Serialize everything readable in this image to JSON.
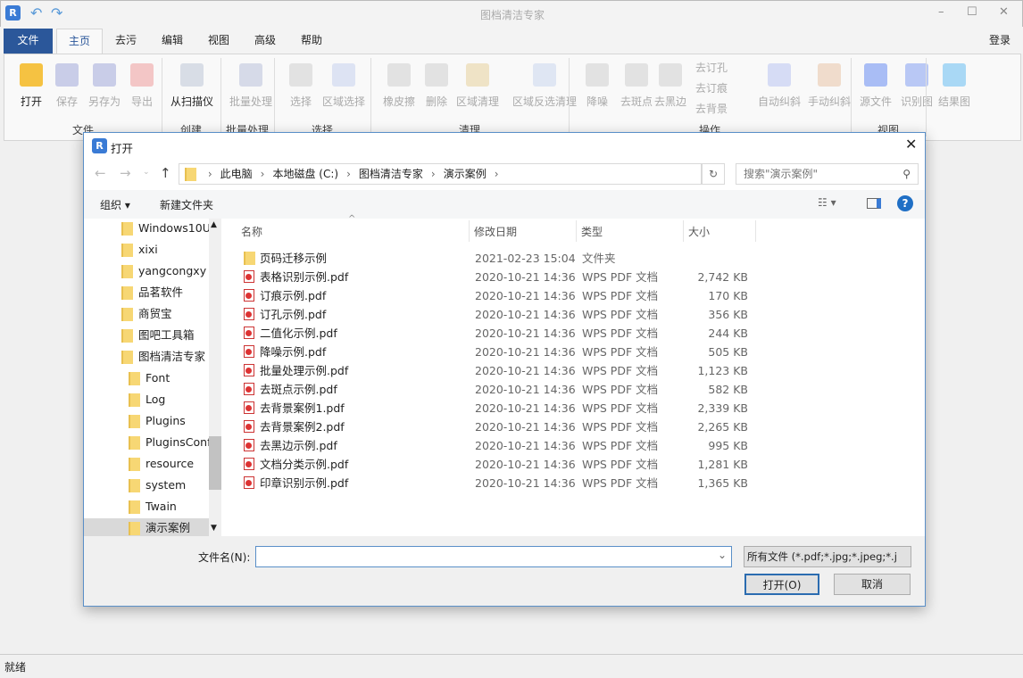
{
  "window": {
    "title": "图档清洁专家",
    "minimize": "–",
    "maximize": "☐",
    "close": "✕",
    "login": "登录",
    "icon": "app-logo-icon"
  },
  "tabs": [
    {
      "label": "文件"
    },
    {
      "label": "主页"
    },
    {
      "label": "去污"
    },
    {
      "label": "编辑"
    },
    {
      "label": "视图"
    },
    {
      "label": "高级"
    },
    {
      "label": "帮助"
    }
  ],
  "ribbon": {
    "buttons": [
      {
        "label": "打开",
        "icon": "folder-open-icon",
        "color": "#f5c242"
      },
      {
        "label": "保存",
        "icon": "save-icon",
        "color": "#c9cde8"
      },
      {
        "label": "另存为",
        "icon": "save-as-icon",
        "color": "#c9cde8"
      },
      {
        "label": "导出",
        "icon": "export-icon",
        "color": "#f3c6c6"
      },
      {
        "label": "从扫描仪",
        "icon": "scanner-icon",
        "color": "#d8dde6"
      },
      {
        "label": "批量处理",
        "icon": "batch-icon",
        "color": "#d6dae8"
      },
      {
        "label": "选择",
        "icon": "cursor-icon",
        "color": "#e2e2e2"
      },
      {
        "label": "区域选择",
        "icon": "area-select-icon",
        "color": "#dde3f3"
      },
      {
        "label": "橡皮擦",
        "icon": "eraser-icon",
        "color": "#e2e2e2"
      },
      {
        "label": "删除",
        "icon": "trash-icon",
        "color": "#e2e2e2"
      },
      {
        "label": "区域清理",
        "icon": "area-clean-icon",
        "color": "#efe3c6"
      },
      {
        "label": "区域反选清理",
        "icon": "area-invert-clean-icon",
        "color": "#dfe6f3"
      },
      {
        "label": "降噪",
        "icon": "denoise-icon",
        "color": "#e2e2e2"
      },
      {
        "label": "去斑点",
        "icon": "despeckle-icon",
        "color": "#e2e2e2"
      },
      {
        "label": "去黑边",
        "icon": "remove-border-icon",
        "color": "#e2e2e2"
      },
      {
        "label": "自动纠斜",
        "icon": "auto-deskew-icon",
        "color": "#d6dcf5"
      },
      {
        "label": "手动纠斜",
        "icon": "manual-deskew-icon",
        "color": "#f0dccc"
      },
      {
        "label": "源文件",
        "icon": "source-image-icon",
        "color": "#a9bdf5"
      },
      {
        "label": "识别图",
        "icon": "recognized-image-icon",
        "color": "#b9c8f5"
      },
      {
        "label": "结果图",
        "icon": "result-image-icon",
        "color": "#a9d8f5"
      }
    ],
    "small": [
      {
        "label": "去订孔"
      },
      {
        "label": "去订痕"
      },
      {
        "label": "去背景"
      }
    ],
    "groups": [
      "文件",
      "创建",
      "批量处理",
      "选择",
      "清理",
      "操作",
      "视图"
    ]
  },
  "dialog": {
    "title": "打开",
    "breadcrumb": [
      "此电脑",
      "本地磁盘 (C:)",
      "图档清洁专家",
      "演示案例"
    ],
    "search_placeholder": "搜索\"演示案例\"",
    "organize": "组织 ▾",
    "new_folder": "新建文件夹",
    "nav": [
      {
        "label": "Windows10U|",
        "lvl": 0
      },
      {
        "label": "xixi",
        "lvl": 0
      },
      {
        "label": "yangcongxy",
        "lvl": 0
      },
      {
        "label": "品茗软件",
        "lvl": 0
      },
      {
        "label": "商贸宝",
        "lvl": 0
      },
      {
        "label": "图吧工具箱",
        "lvl": 0
      },
      {
        "label": "图档清洁专家",
        "lvl": 0
      },
      {
        "label": "Font",
        "lvl": 1
      },
      {
        "label": "Log",
        "lvl": 1
      },
      {
        "label": "Plugins",
        "lvl": 1
      },
      {
        "label": "PluginsConfi",
        "lvl": 1
      },
      {
        "label": "resource",
        "lvl": 1
      },
      {
        "label": "system",
        "lvl": 1
      },
      {
        "label": "Twain",
        "lvl": 1
      },
      {
        "label": "演示案例",
        "lvl": 1,
        "selected": true
      }
    ],
    "columns": [
      "名称",
      "修改日期",
      "类型",
      "大小"
    ],
    "files": [
      {
        "name": "页码迁移示例",
        "date": "2021-02-23 15:04",
        "type": "文件夹",
        "size": "",
        "kind": "folder"
      },
      {
        "name": "表格识别示例.pdf",
        "date": "2020-10-21 14:36",
        "type": "WPS PDF 文档",
        "size": "2,742 KB",
        "kind": "pdf"
      },
      {
        "name": "订痕示例.pdf",
        "date": "2020-10-21 14:36",
        "type": "WPS PDF 文档",
        "size": "170 KB",
        "kind": "pdf"
      },
      {
        "name": "订孔示例.pdf",
        "date": "2020-10-21 14:36",
        "type": "WPS PDF 文档",
        "size": "356 KB",
        "kind": "pdf"
      },
      {
        "name": "二值化示例.pdf",
        "date": "2020-10-21 14:36",
        "type": "WPS PDF 文档",
        "size": "244 KB",
        "kind": "pdf"
      },
      {
        "name": "降噪示例.pdf",
        "date": "2020-10-21 14:36",
        "type": "WPS PDF 文档",
        "size": "505 KB",
        "kind": "pdf"
      },
      {
        "name": "批量处理示例.pdf",
        "date": "2020-10-21 14:36",
        "type": "WPS PDF 文档",
        "size": "1,123 KB",
        "kind": "pdf"
      },
      {
        "name": "去斑点示例.pdf",
        "date": "2020-10-21 14:36",
        "type": "WPS PDF 文档",
        "size": "582 KB",
        "kind": "pdf"
      },
      {
        "name": "去背景案例1.pdf",
        "date": "2020-10-21 14:36",
        "type": "WPS PDF 文档",
        "size": "2,339 KB",
        "kind": "pdf"
      },
      {
        "name": "去背景案例2.pdf",
        "date": "2020-10-21 14:36",
        "type": "WPS PDF 文档",
        "size": "2,265 KB",
        "kind": "pdf"
      },
      {
        "name": "去黑边示例.pdf",
        "date": "2020-10-21 14:36",
        "type": "WPS PDF 文档",
        "size": "995 KB",
        "kind": "pdf"
      },
      {
        "name": "文档分类示例.pdf",
        "date": "2020-10-21 14:36",
        "type": "WPS PDF 文档",
        "size": "1,281 KB",
        "kind": "pdf"
      },
      {
        "name": "印章识别示例.pdf",
        "date": "2020-10-21 14:36",
        "type": "WPS PDF 文档",
        "size": "1,365 KB",
        "kind": "pdf"
      }
    ],
    "filename_label": "文件名(N):",
    "filename_value": "",
    "filter": "所有文件 (*.pdf;*.jpg;*.jpeg;*.j",
    "open_button": "打开(O)",
    "cancel_button": "取消"
  },
  "status": "就绪",
  "colors": {
    "accent": "#2b579a",
    "dialog_border": "#5a8fc8"
  }
}
